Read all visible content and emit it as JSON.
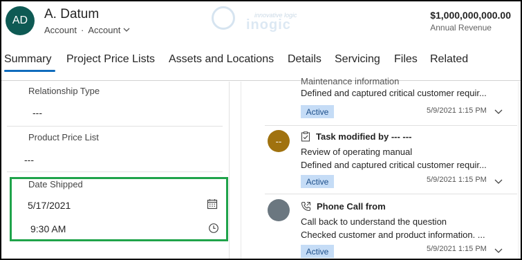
{
  "header": {
    "avatar_initials": "AD",
    "account_name": "A. Datum",
    "entity_type": "Account",
    "separator": "·",
    "form_name": "Account",
    "revenue_value": "$1,000,000,000.00",
    "revenue_label": "Annual Revenue",
    "watermark_tagline": "innovative logic",
    "watermark_word": "inogic"
  },
  "tabs": [
    {
      "label": "Summary",
      "active": true
    },
    {
      "label": "Project Price Lists",
      "active": false
    },
    {
      "label": "Assets and Locations",
      "active": false
    },
    {
      "label": "Details",
      "active": false
    },
    {
      "label": "Servicing",
      "active": false
    },
    {
      "label": "Files",
      "active": false
    },
    {
      "label": "Related",
      "active": false
    }
  ],
  "fields": {
    "relationship_type": {
      "label": "Relationship Type",
      "value": "---"
    },
    "product_price_list": {
      "label": "Product Price List",
      "value": "---"
    },
    "date_shipped": {
      "label": "Date Shipped",
      "date": "5/17/2021",
      "time": "9:30 AM"
    }
  },
  "timeline": [
    {
      "partial_line": "Maintenance information",
      "line": "Defined and captured critical customer requir...",
      "status": "Active",
      "timestamp": "5/9/2021 1:15 PM"
    },
    {
      "avatar_initials": "--",
      "avatar_color": "#a0720f",
      "title": "Task modified by --- ---",
      "icon": "task-icon",
      "line1": "Review of operating manual",
      "line2": "Defined and captured critical customer requir...",
      "status": "Active",
      "timestamp": "5/9/2021 1:15 PM"
    },
    {
      "avatar_color": "#6b7780",
      "title": "Phone Call from",
      "icon": "phone-icon",
      "line1": "Call back to understand the question",
      "line2": "Checked customer and product information. ...",
      "status": "Active",
      "timestamp": "5/9/2021 1:15 PM"
    }
  ],
  "colors": {
    "accent": "#0f6cbd",
    "highlight_border": "#1fa34a",
    "badge_bg": "#c5dcf6",
    "avatar_bg": "#0e5a54"
  }
}
